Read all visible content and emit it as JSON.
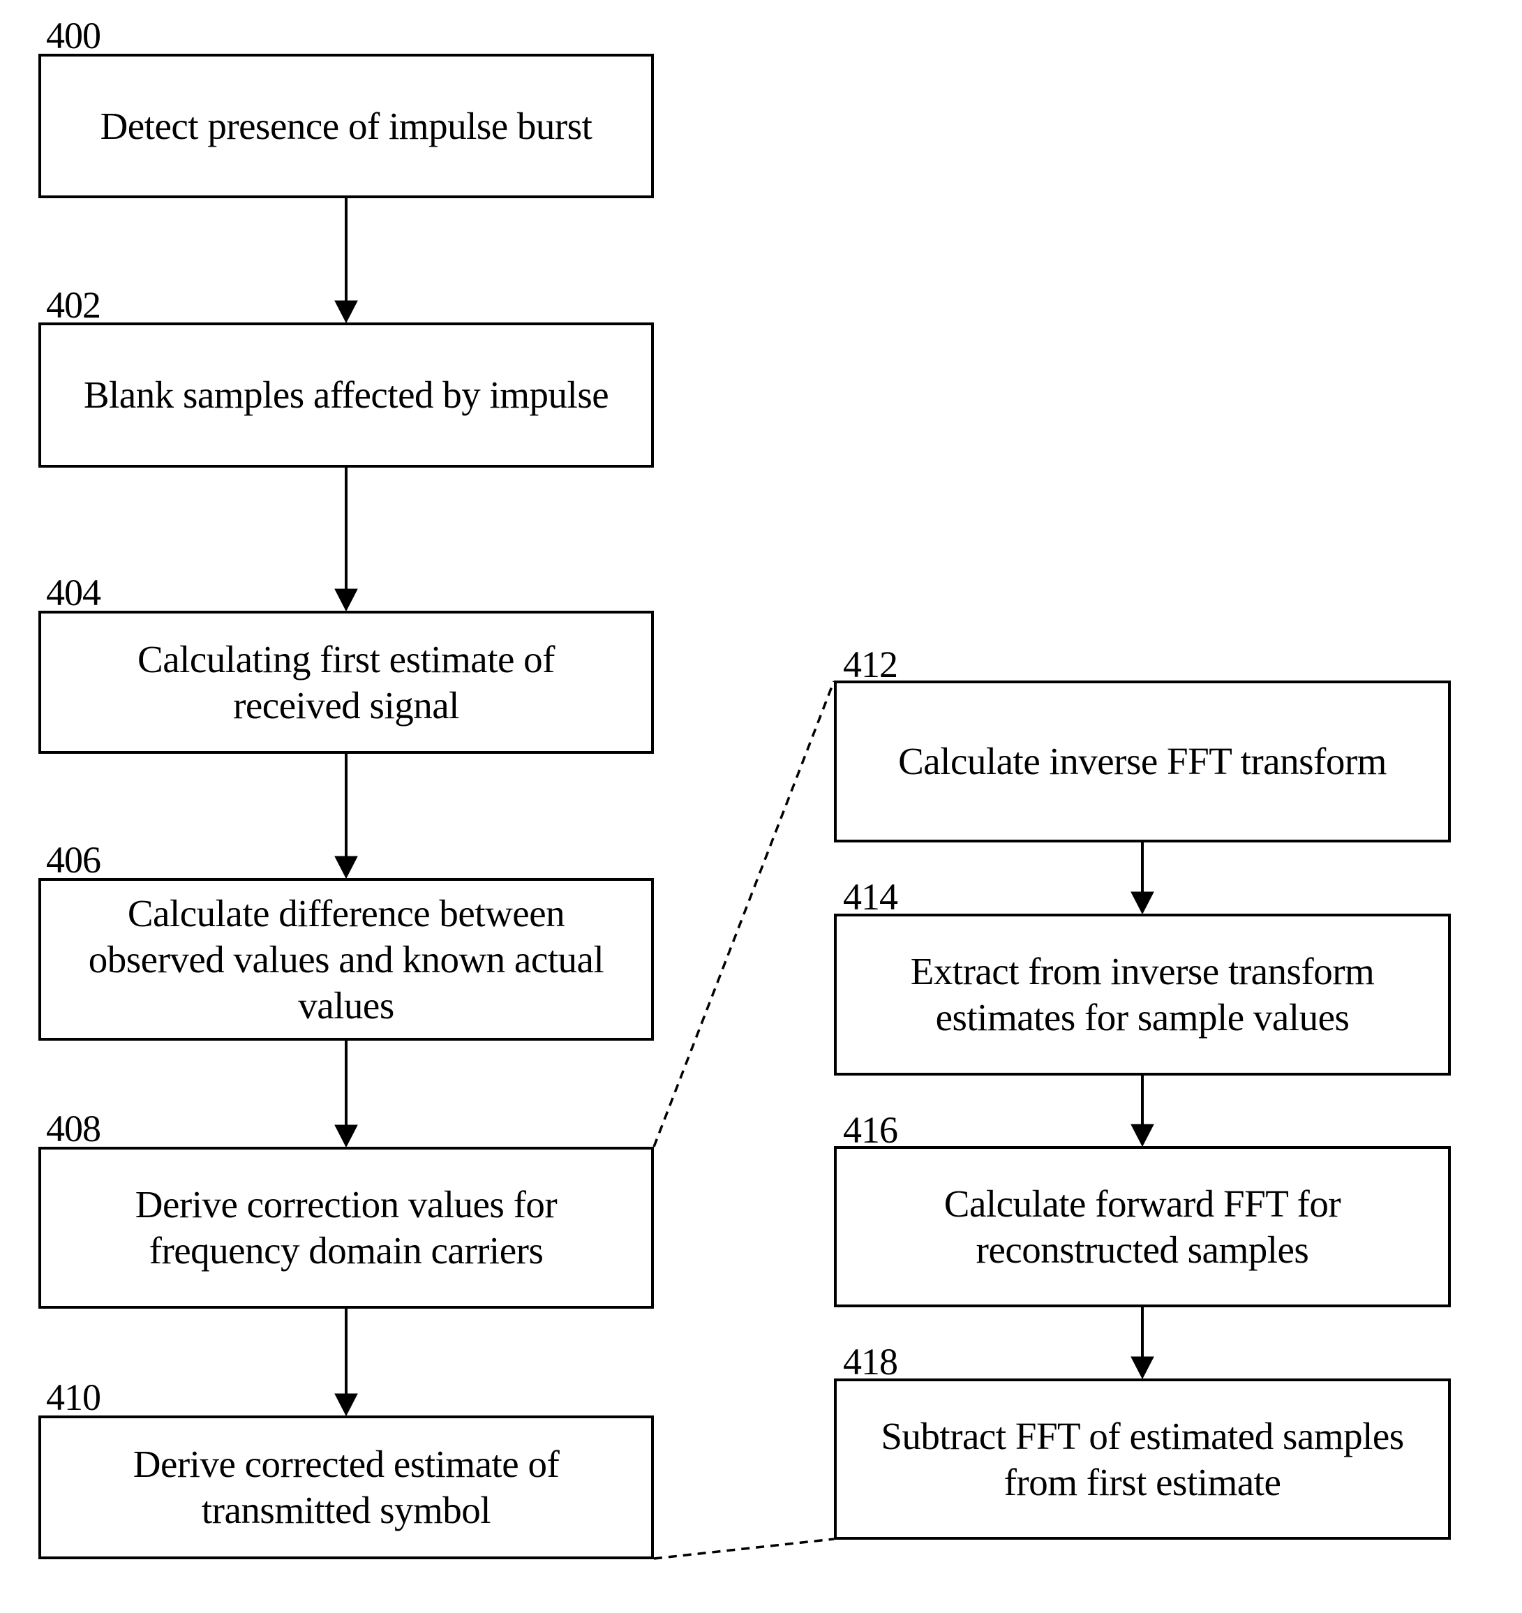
{
  "diagram": {
    "type": "flowchart",
    "left_column": [
      {
        "ref": "400",
        "text": "Detect presence of impulse burst"
      },
      {
        "ref": "402",
        "text": "Blank samples affected by impulse"
      },
      {
        "ref": "404",
        "text": "Calculating first estimate of\nreceived signal"
      },
      {
        "ref": "406",
        "text": "Calculate difference between\nobserved values and known actual\nvalues"
      },
      {
        "ref": "408",
        "text": "Derive correction values for\nfrequency domain carriers"
      },
      {
        "ref": "410",
        "text": "Derive corrected estimate of\ntransmitted symbol"
      }
    ],
    "right_column": [
      {
        "ref": "412",
        "text": "Calculate inverse FFT transform"
      },
      {
        "ref": "414",
        "text": "Extract from inverse transform\nestimates for sample values"
      },
      {
        "ref": "416",
        "text": "Calculate forward FFT for\nreconstructed samples"
      },
      {
        "ref": "418",
        "text": "Subtract FFT of estimated samples\nfrom first estimate"
      }
    ],
    "flow_edges": [
      [
        "400",
        "402"
      ],
      [
        "402",
        "404"
      ],
      [
        "404",
        "406"
      ],
      [
        "406",
        "408"
      ],
      [
        "408",
        "410"
      ],
      [
        "412",
        "414"
      ],
      [
        "414",
        "416"
      ],
      [
        "416",
        "418"
      ]
    ],
    "expansion": {
      "expanded_step": "408",
      "detail_steps": [
        "412",
        "414",
        "416",
        "418"
      ],
      "style": "dashed"
    }
  }
}
